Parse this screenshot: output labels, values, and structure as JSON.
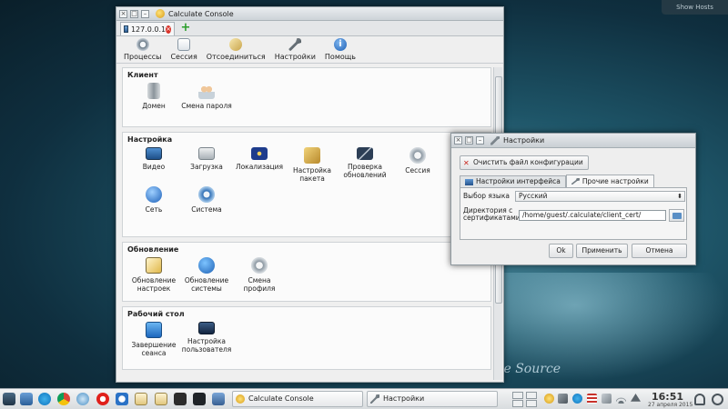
{
  "desktop": {
    "brand_text": "ke Source",
    "corner_label": "Show Hosts"
  },
  "main_window": {
    "title": "Calculate Console",
    "connection_tab": "127.0.0.1",
    "toolbar": [
      "Процессы",
      "Сессия",
      "Отсоединиться",
      "Настройки",
      "Помощь"
    ],
    "sections": [
      {
        "title": "Клиент",
        "items": [
          "Домен",
          "Смена пароля"
        ]
      },
      {
        "title": "Настройка",
        "items": [
          "Видео",
          "Загрузка",
          "Локализация",
          "Настройка пакета",
          "Проверка обновлений",
          "Сессия",
          "Сеть",
          "Система"
        ]
      },
      {
        "title": "Обновление",
        "items": [
          "Обновление настроек",
          "Обновление системы",
          "Смена профиля"
        ]
      },
      {
        "title": "Рабочий стол",
        "items": [
          "Завершение сеанса",
          "Настройка пользователя"
        ]
      }
    ]
  },
  "dialog": {
    "title": "Настройки",
    "clear_button": "Очистить файл конфигурации",
    "tabs": [
      "Настройки интерфейса",
      "Прочие настройки"
    ],
    "active_tab": "Прочие настройки",
    "language_label": "Выбор языка",
    "language_value": "Русский",
    "cert_dir_label": "Директория с сертификатами",
    "cert_dir_value": "/home/guest/.calculate/client_cert/",
    "buttons": {
      "ok": "Ok",
      "apply": "Применить",
      "cancel": "Отмена"
    }
  },
  "taskbar": {
    "tasks": [
      "Calculate Console",
      "Настройки"
    ],
    "clock_time": "16:51",
    "clock_date": "27 апреля 2015"
  },
  "colors": {
    "accent_blue": "#2f5f96",
    "close_red": "#d9342b",
    "add_green": "#2a9d2a"
  }
}
